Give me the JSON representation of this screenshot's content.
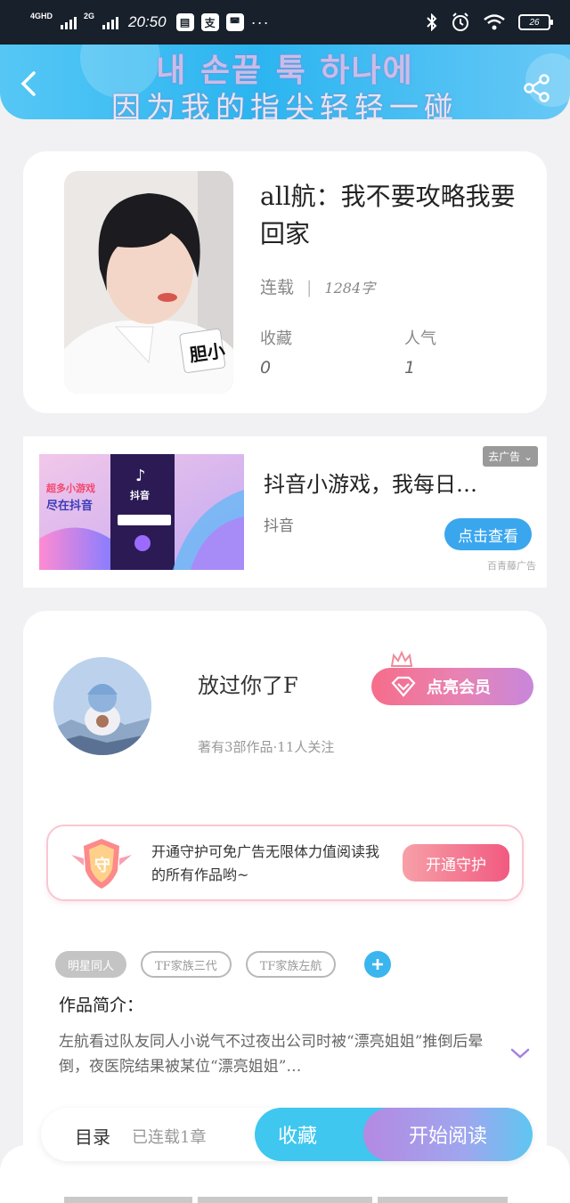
{
  "status_bar": {
    "network1": "4GHD",
    "network2": "2G",
    "time": "20:50",
    "app1": "▤",
    "app2": "支",
    "app3": "◚",
    "more": "···",
    "battery": "26"
  },
  "header": {
    "line1": "내 손끝 툭 하나에",
    "line2": "因为我的指尖轻轻一碰"
  },
  "book": {
    "title": "all航：我不要攻略我要回家",
    "status": "连载",
    "word_count": "1284字",
    "favorites_label": "收藏",
    "favorites_value": "0",
    "popularity_label": "人气",
    "popularity_value": "1",
    "cover_text": "胆小"
  },
  "ad": {
    "close_label": "去广告",
    "title": "抖音小游戏，我每日…",
    "source": "抖音",
    "button": "点击查看",
    "tag": "百青藤广告",
    "banner_line1": "超多小游戏",
    "banner_line2": "尽在抖音",
    "banner_brand": "抖音"
  },
  "author": {
    "name": "放过你了F",
    "meta": "著有3部作品·11人关注",
    "vip_button": "点亮会员",
    "guard_text": "开通守护可免广告无限体力值阅读我的所有作品哟~",
    "guard_badge": "守",
    "guard_button": "开通守护",
    "tags": [
      "明星同人",
      "TF家族三代",
      "TF家族左航"
    ],
    "intro_label": "作品简介：",
    "intro_text": "左航看过队友同人小说气不过夜出公司时被“漂亮姐姐”推倒后晕倒，夜医院结果被某位“漂亮姐姐”…"
  },
  "bottom": {
    "toc": "目录",
    "toc_status": "已连载1章",
    "favorite": "收藏",
    "read": "开始阅读"
  },
  "colors": {
    "accent_blue": "#3bb5ee",
    "vip_pink": "#f66d8a",
    "read_purple": "#b489e2"
  }
}
